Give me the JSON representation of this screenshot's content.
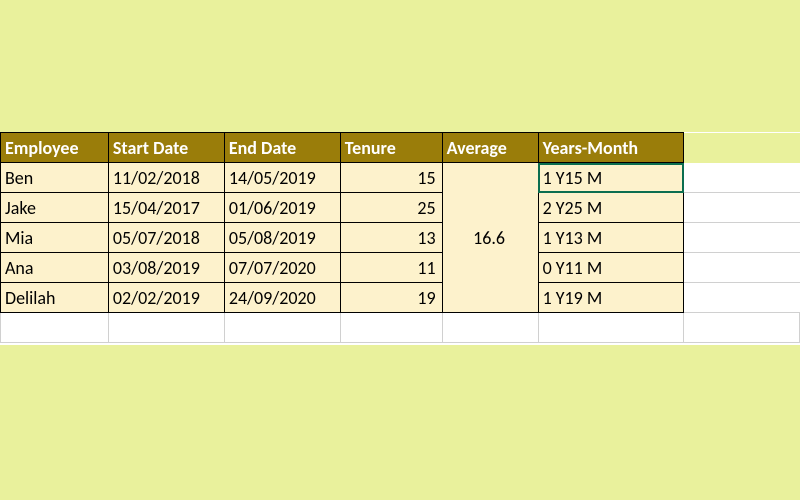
{
  "colors": {
    "header_bg": "#9a7d0a",
    "header_fg": "#ffffff",
    "cell_bg": "#fdf2cc",
    "pale_bg": "#e9f19c",
    "select_outline": "#0b6e4f"
  },
  "headers": {
    "employee": "Employee",
    "start_date": "Start Date",
    "end_date": "End Date",
    "tenure": "Tenure",
    "average": "Average",
    "years_month": "Years-Month"
  },
  "rows": [
    {
      "employee": "Ben",
      "start_date": "11/02/2018",
      "end_date": "14/05/2019",
      "tenure": "15",
      "years_month": "1 Y15 M"
    },
    {
      "employee": "Jake",
      "start_date": "15/04/2017",
      "end_date": "01/06/2019",
      "tenure": "25",
      "years_month": "2 Y25 M"
    },
    {
      "employee": "Mia",
      "start_date": "05/07/2018",
      "end_date": "05/08/2019",
      "tenure": "13",
      "years_month": "1 Y13 M"
    },
    {
      "employee": "Ana",
      "start_date": "03/08/2019",
      "end_date": "07/07/2020",
      "tenure": "11",
      "years_month": "0 Y11 M"
    },
    {
      "employee": "Delilah",
      "start_date": "02/02/2019",
      "end_date": "24/09/2020",
      "tenure": "19",
      "years_month": "1 Y19 M"
    }
  ],
  "average": "16.6",
  "selected_cell": {
    "row": 0,
    "col": "years_month"
  }
}
